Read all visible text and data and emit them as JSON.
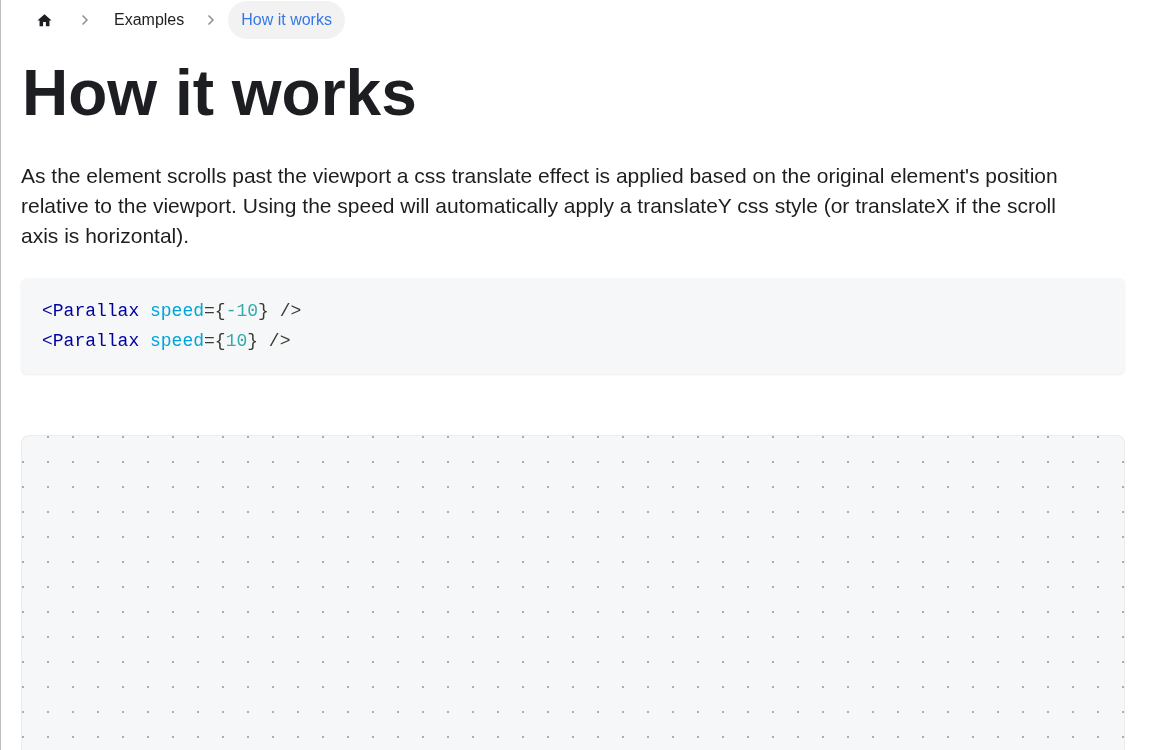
{
  "breadcrumb": {
    "items": [
      {
        "label": "Examples",
        "selected": false
      },
      {
        "label": "How it works",
        "selected": true
      }
    ]
  },
  "heading": "How it works",
  "paragraph": "As the element scrolls past the viewport a css translate effect is applied based on the original element's position relative to the viewport. Using the speed will automatically apply a translateY css style (or translateX if the scroll axis is horizontal).",
  "code_block": {
    "lines": [
      [
        {
          "text": "<Parallax",
          "kind": "tag"
        },
        {
          "text": " speed",
          "kind": "attr"
        },
        {
          "text": "={",
          "kind": "punct"
        },
        {
          "text": "-10",
          "kind": "number"
        },
        {
          "text": "} />",
          "kind": "punct"
        }
      ],
      [
        {
          "text": "<Parallax",
          "kind": "tag"
        },
        {
          "text": " speed",
          "kind": "attr"
        },
        {
          "text": "={",
          "kind": "punct"
        },
        {
          "text": "10",
          "kind": "number"
        },
        {
          "text": "} />",
          "kind": "punct"
        }
      ]
    ]
  }
}
